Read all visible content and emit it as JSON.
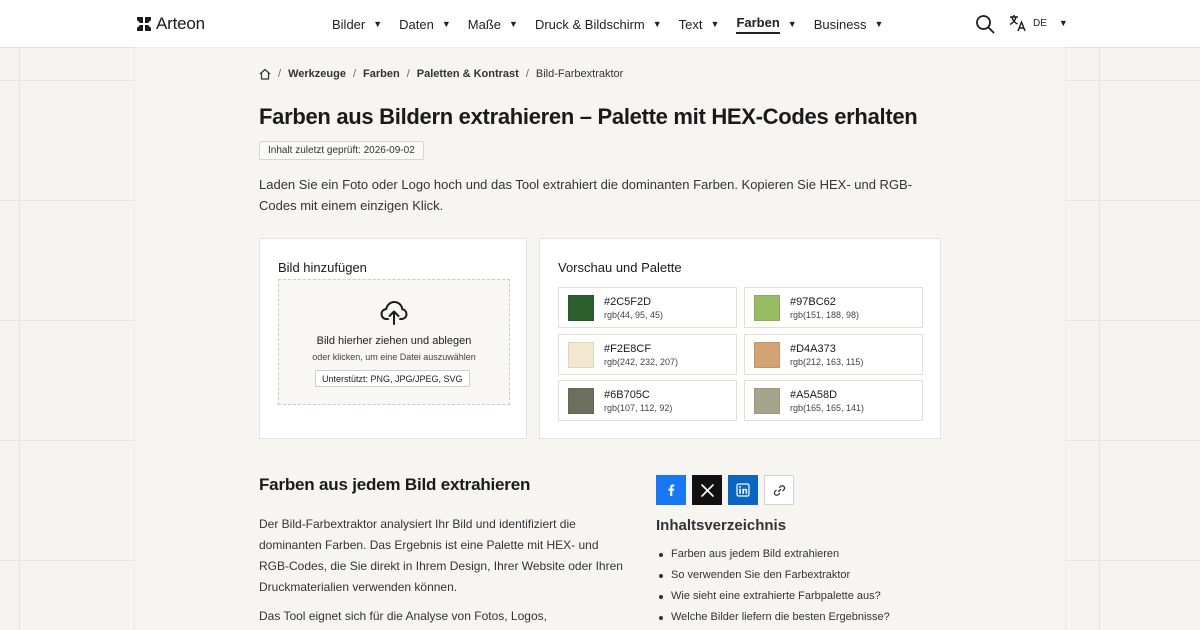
{
  "header": {
    "brand": "Arteon",
    "nav": [
      {
        "label": "Bilder",
        "active": false
      },
      {
        "label": "Daten",
        "active": false
      },
      {
        "label": "Maße",
        "active": false
      },
      {
        "label": "Druck & Bildschirm",
        "active": false
      },
      {
        "label": "Text",
        "active": false
      },
      {
        "label": "Farben",
        "active": true
      },
      {
        "label": "Business",
        "active": false
      }
    ],
    "caret": "▼",
    "language": "DE",
    "icons": {
      "search": "search-icon",
      "translate": "translate-icon",
      "logo": "logo-icon"
    }
  },
  "breadcrumb": {
    "separator": "/",
    "items": [
      "Werkzeuge",
      "Farben",
      "Paletten & Kontrast"
    ],
    "current": "Bild-Farbextraktor"
  },
  "page": {
    "title": "Farben aus Bildern extrahieren – Palette mit HEX-Codes erhalten",
    "date_badge": "Inhalt zuletzt geprüft: 2026-09-02",
    "intro": "Laden Sie ein Foto oder Logo hoch und das Tool extrahiert die dominanten Farben. Kopieren Sie HEX- und RGB-Codes mit einem einzigen Klick."
  },
  "upload": {
    "title": "Bild hinzufügen",
    "drop_title": "Bild hierher ziehen und ablegen",
    "drop_sub": "oder klicken, um eine Datei auszuwählen",
    "formats": "Unterstützt: PNG, JPG/JPEG, SVG"
  },
  "preview": {
    "title": "Vorschau und Palette",
    "swatches": [
      {
        "hex": "#2C5F2D",
        "rgb": "rgb(44, 95, 45)",
        "color": "#2C5F2D"
      },
      {
        "hex": "#97BC62",
        "rgb": "rgb(151, 188, 98)",
        "color": "#97BC62"
      },
      {
        "hex": "#F2E8CF",
        "rgb": "rgb(242, 232, 207)",
        "color": "#F2E8CF"
      },
      {
        "hex": "#D4A373",
        "rgb": "rgb(212, 163, 115)",
        "color": "#D4A373"
      },
      {
        "hex": "#6B705C",
        "rgb": "rgb(107, 112, 92)",
        "color": "#6B705C"
      },
      {
        "hex": "#A5A58D",
        "rgb": "rgb(165, 165, 141)",
        "color": "#A5A58D"
      }
    ]
  },
  "article": {
    "section_title": "Farben aus jedem Bild extrahieren",
    "paragraph_1": "Der Bild-Farbextraktor analysiert Ihr Bild und identifiziert die dominanten Farben. Das Ergebnis ist eine Palette mit HEX- und RGB-Codes, die Sie direkt in Ihrem Design, Ihrer Website oder Ihren Druckmaterialien verwenden können.",
    "paragraph_2": "Das Tool eignet sich für die Analyse von Fotos, Logos,"
  },
  "share": {
    "facebook": "facebook-icon",
    "x": "x-icon",
    "linkedin": "linkedin-icon",
    "link": "link-icon",
    "colors": {
      "facebook": "#1877F2",
      "x": "#111111",
      "linkedin": "#0A66C2"
    }
  },
  "toc": {
    "title": "Inhaltsverzeichnis",
    "items": [
      "Farben aus jedem Bild extrahieren",
      "So verwenden Sie den Farbextraktor",
      "Wie sieht eine extrahierte Farbpalette aus?",
      "Welche Bilder liefern die besten Ergebnisse?"
    ]
  }
}
